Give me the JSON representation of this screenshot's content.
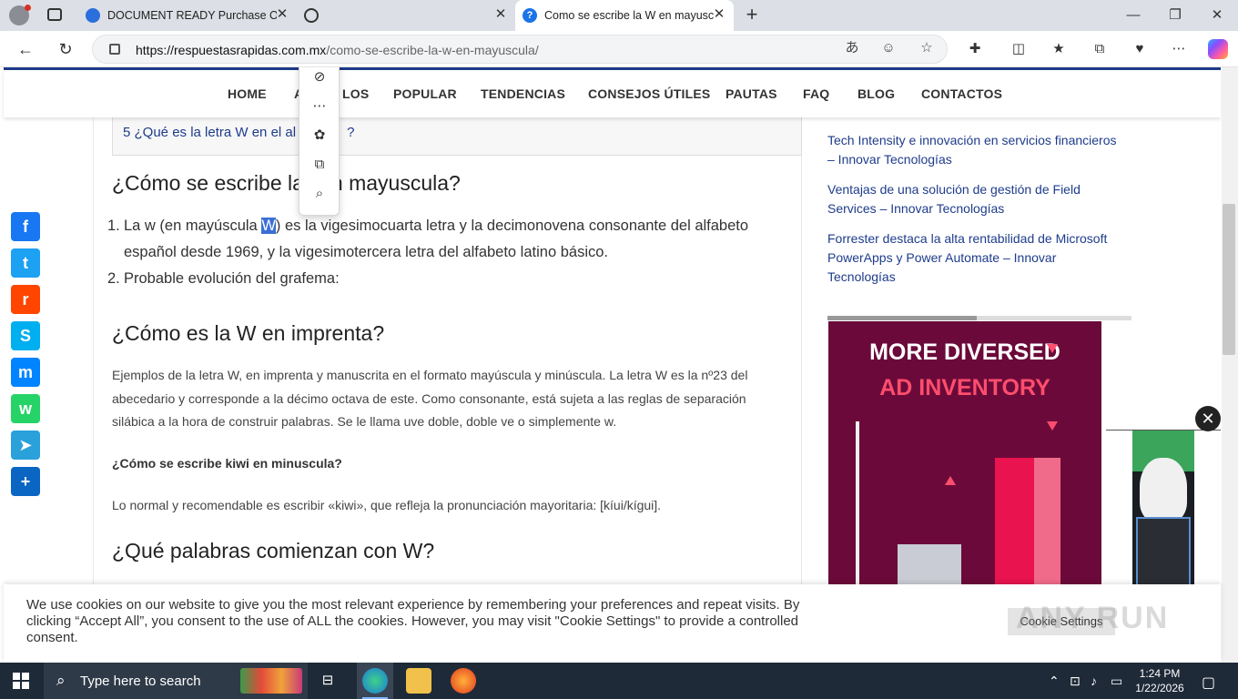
{
  "browser": {
    "tabs": [
      {
        "title": "DOCUMENT READY Purchase Orc"
      },
      {
        "title": ""
      },
      {
        "title": "Como se escribe la W en mayuscu"
      }
    ],
    "url_host": "https://respuestasrapidas.com.mx",
    "url_path": "/como-se-escribe-la-w-en-mayuscula/"
  },
  "site_nav": {
    "items": [
      "HOME",
      "A",
      "LOS",
      "POPULAR",
      "TENDENCIAS",
      "CONSEJOS ÚTILES",
      "PAUTAS",
      "FAQ",
      "BLOG",
      "CONTACTOS"
    ]
  },
  "toc": {
    "line_a": "5 ¿Qué es la letra W en el al",
    "line_b": "?"
  },
  "article": {
    "h2_1a": "¿Cómo se escribe la",
    "h2_1b": "n mayuscula?",
    "li1_num": "1.",
    "li1_a": "La w (en mayúscula ",
    "li1_sel": "W",
    "li1_b": ") es la vigesimocuarta letra y la decimonovena consonante del alfabeto",
    "li1_c": "español desde 1969, y la vigesimotercera letra del alfabeto latino básico.",
    "li2_num": "2.",
    "li2": "Probable evolución del grafema:",
    "h2_2": "¿Cómo es la W en imprenta?",
    "p1_l1": "Ejemplos de la letra W, en imprenta y manuscrita en el formato mayúscula y minúscula. La letra W es la nº23 del",
    "p1_l2": "abecedario y corresponde a la décimo octava de este. Como consonante, está sujeta a las reglas de separación",
    "p1_l3": "silábica a la hora de construir palabras. Se le llama uve doble, doble ve o simplemente w.",
    "q1": "¿Cómo se escribe kiwi en minuscula?",
    "p2": "Lo normal y recomendable es escribir «kiwi», que refleja la pronunciación mayoritaria: [kíui/kígui].",
    "h2_3": "¿Qué palabras comienzan con W?"
  },
  "sidebar": {
    "links": [
      {
        "l1": "Tech Intensity e innovación en servicios financieros",
        "l2": "– Innovar Tecnologías",
        "l3": ""
      },
      {
        "l1": "Ventajas de una solución de gestión de Field",
        "l2": "Services – Innovar Tecnologías",
        "l3": ""
      },
      {
        "l1": "Forrester destaca la alta rentabilidad de Microsoft",
        "l2": "PowerApps y Power Automate – Innovar",
        "l3": "Tecnologías"
      }
    ]
  },
  "ad": {
    "line1": "MORE DIVERSED",
    "line2": "AD INVENTORY",
    "progress_fraction": 0.49
  },
  "share": [
    {
      "icon": "facebook-icon",
      "glyph": "f",
      "color": "#1877f2"
    },
    {
      "icon": "twitter-icon",
      "glyph": "t",
      "color": "#1da1f2"
    },
    {
      "icon": "reddit-icon",
      "glyph": "r",
      "color": "#ff4500"
    },
    {
      "icon": "skype-icon",
      "glyph": "S",
      "color": "#00aff0"
    },
    {
      "icon": "messenger-icon",
      "glyph": "m",
      "color": "#0084ff"
    },
    {
      "icon": "whatsapp-icon",
      "glyph": "w",
      "color": "#25d366"
    },
    {
      "icon": "telegram-icon",
      "glyph": "➤",
      "color": "#2aa1da"
    },
    {
      "icon": "share-plus-icon",
      "glyph": "+",
      "color": "#0a66c2"
    }
  ],
  "mini_menu": [
    "eye-off-icon",
    "more-icon",
    "copilot-icon",
    "copy-icon",
    "search-icon"
  ],
  "cookie": {
    "text": "We use cookies on our website to give you the most relevant experience by remembering your preferences and repeat visits. By clicking “Accept All”, you consent to the use of ALL the cookies. However, you may visit \"Cookie Settings\" to provide a controlled consent.",
    "settings_label": "Cookie Settings",
    "watermark": "ANY RUN"
  },
  "taskbar": {
    "search_placeholder": "Type here to search",
    "time": "1:24 PM",
    "date": "1/22/2026"
  }
}
